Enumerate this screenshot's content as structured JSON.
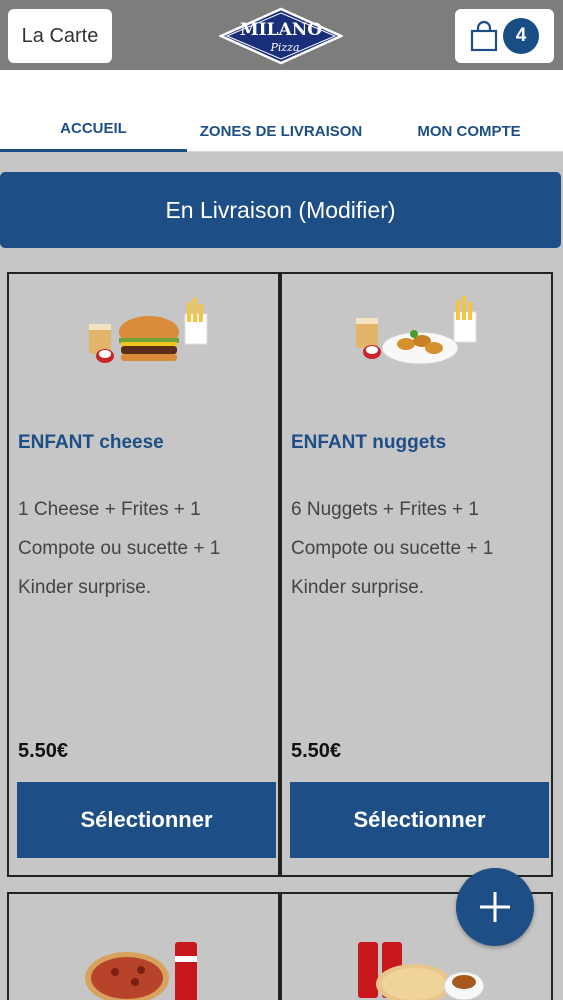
{
  "header": {
    "menu_label": "La Carte",
    "logo_text": "MILANO",
    "logo_subtext": "Pizza",
    "cart_count": "4"
  },
  "tabs": [
    {
      "label": "ACCUEIL",
      "active": true
    },
    {
      "label": "ZONES DE LIVRAISON",
      "active": false
    },
    {
      "label": "MON COMPTE",
      "active": false
    }
  ],
  "delivery": {
    "label": "En Livraison (Modifier)"
  },
  "products": [
    {
      "title": "ENFANT cheese",
      "description": "1 Cheese  + Frites  + 1 Compote ou sucette  + 1 Kinder surprise.",
      "price": "5.50€",
      "button": "Sélectionner",
      "image": "kids-cheeseburger-meal"
    },
    {
      "title": "ENFANT nuggets",
      "description": "6 Nuggets  + Frites  + 1 Compote ou sucette  + 1 Kinder surprise.",
      "price": "5.50€",
      "button": "Sélectionner",
      "image": "kids-nuggets-meal"
    },
    {
      "image": "pizza-cola-wings-menu"
    },
    {
      "image": "pizza-colas-wings-menu"
    }
  ],
  "colors": {
    "primary": "#1d4f86",
    "header_bg": "#7d7d7d",
    "page_bg": "#c6c6c6"
  },
  "icons": {
    "cart": "shopping-bag-icon",
    "fab": "plus-icon"
  }
}
